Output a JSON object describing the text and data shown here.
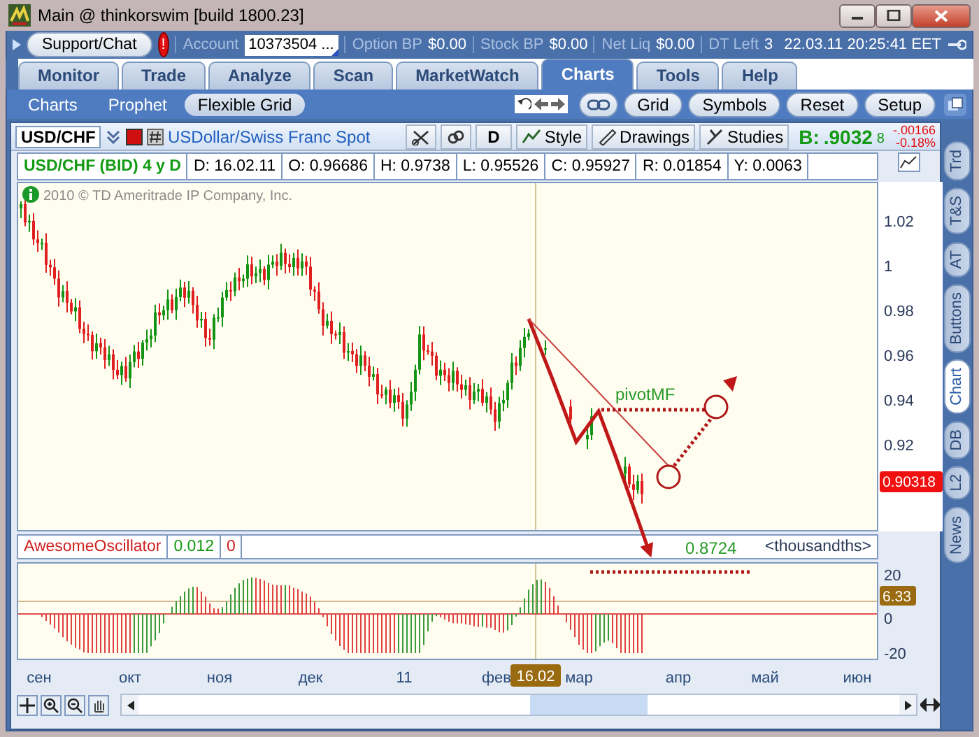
{
  "window": {
    "title": "Main @ thinkorswim [build 1800.23]"
  },
  "top_bar": {
    "support_button": "Support/Chat",
    "alert_badge": "!",
    "account_label": "Account",
    "account_value": "10373504 ...",
    "fields": [
      {
        "label": "Option BP",
        "value": "$0.00"
      },
      {
        "label": "Stock BP",
        "value": "$0.00"
      },
      {
        "label": "Net Liq",
        "value": "$0.00"
      },
      {
        "label": "DT Left",
        "value": "3"
      }
    ],
    "datetime": "22.03.11 20:25:41 EET"
  },
  "tabs": [
    {
      "label": "Monitor",
      "selected": false
    },
    {
      "label": "Trade",
      "selected": false
    },
    {
      "label": "Analyze",
      "selected": false
    },
    {
      "label": "Scan",
      "selected": false
    },
    {
      "label": "MarketWatch",
      "selected": false
    },
    {
      "label": "Charts",
      "selected": true
    },
    {
      "label": "Tools",
      "selected": false
    },
    {
      "label": "Help",
      "selected": false
    }
  ],
  "subtabs": [
    {
      "label": "Charts",
      "selected": false
    },
    {
      "label": "Prophet",
      "selected": false
    },
    {
      "label": "Flexible Grid",
      "selected": true
    }
  ],
  "toolbar_buttons": [
    "Grid",
    "Symbols",
    "Reset",
    "Setup"
  ],
  "chart": {
    "symbol": "USD/CHF",
    "description": "USDollar/Swiss Franc Spot",
    "aggregation": "D",
    "tools": [
      "Style",
      "Drawings",
      "Studies"
    ],
    "bid": {
      "label": "B:",
      "value": ".9032",
      "last_digit": "8"
    },
    "change": "-.00166",
    "change_percent": "-0.18%",
    "info": {
      "title": "USD/CHF (BID) 4 y D",
      "fields": [
        "D: 16.02.11",
        "O: 0.96686",
        "H: 0.9738",
        "L: 0.95526",
        "C: 0.95927",
        "R: 0.01854",
        "Y: 0.0063"
      ]
    },
    "copyright": "2010 © TD Ameritrade IP Company, Inc.",
    "price_axis": [
      "1.02",
      "1",
      "0.98",
      "0.96",
      "0.94",
      "0.92"
    ],
    "price_badge": "0.90318",
    "pivot_label": "pivotMF",
    "target_label": "0.8724",
    "oscillator": {
      "name": "AwesomeOscillator",
      "value": "0.012",
      "value_2": "0",
      "units": "<thousandths>",
      "axis": [
        "20",
        "0",
        "-20"
      ],
      "badge": "6.33"
    },
    "time_axis": [
      "сен",
      "окт",
      "ноя",
      "дек",
      "11",
      "фев",
      "мар",
      "апр",
      "май",
      "июн"
    ],
    "cursor_date": "16.02"
  },
  "side_tabs": [
    {
      "label": "Trd",
      "selected": false
    },
    {
      "label": "T&S",
      "selected": false
    },
    {
      "label": "AT",
      "selected": false
    },
    {
      "label": "Buttons",
      "selected": false
    },
    {
      "label": "Chart",
      "selected": true
    },
    {
      "label": "DB",
      "selected": false
    },
    {
      "label": "L2",
      "selected": false
    },
    {
      "label": "News",
      "selected": false
    }
  ]
}
